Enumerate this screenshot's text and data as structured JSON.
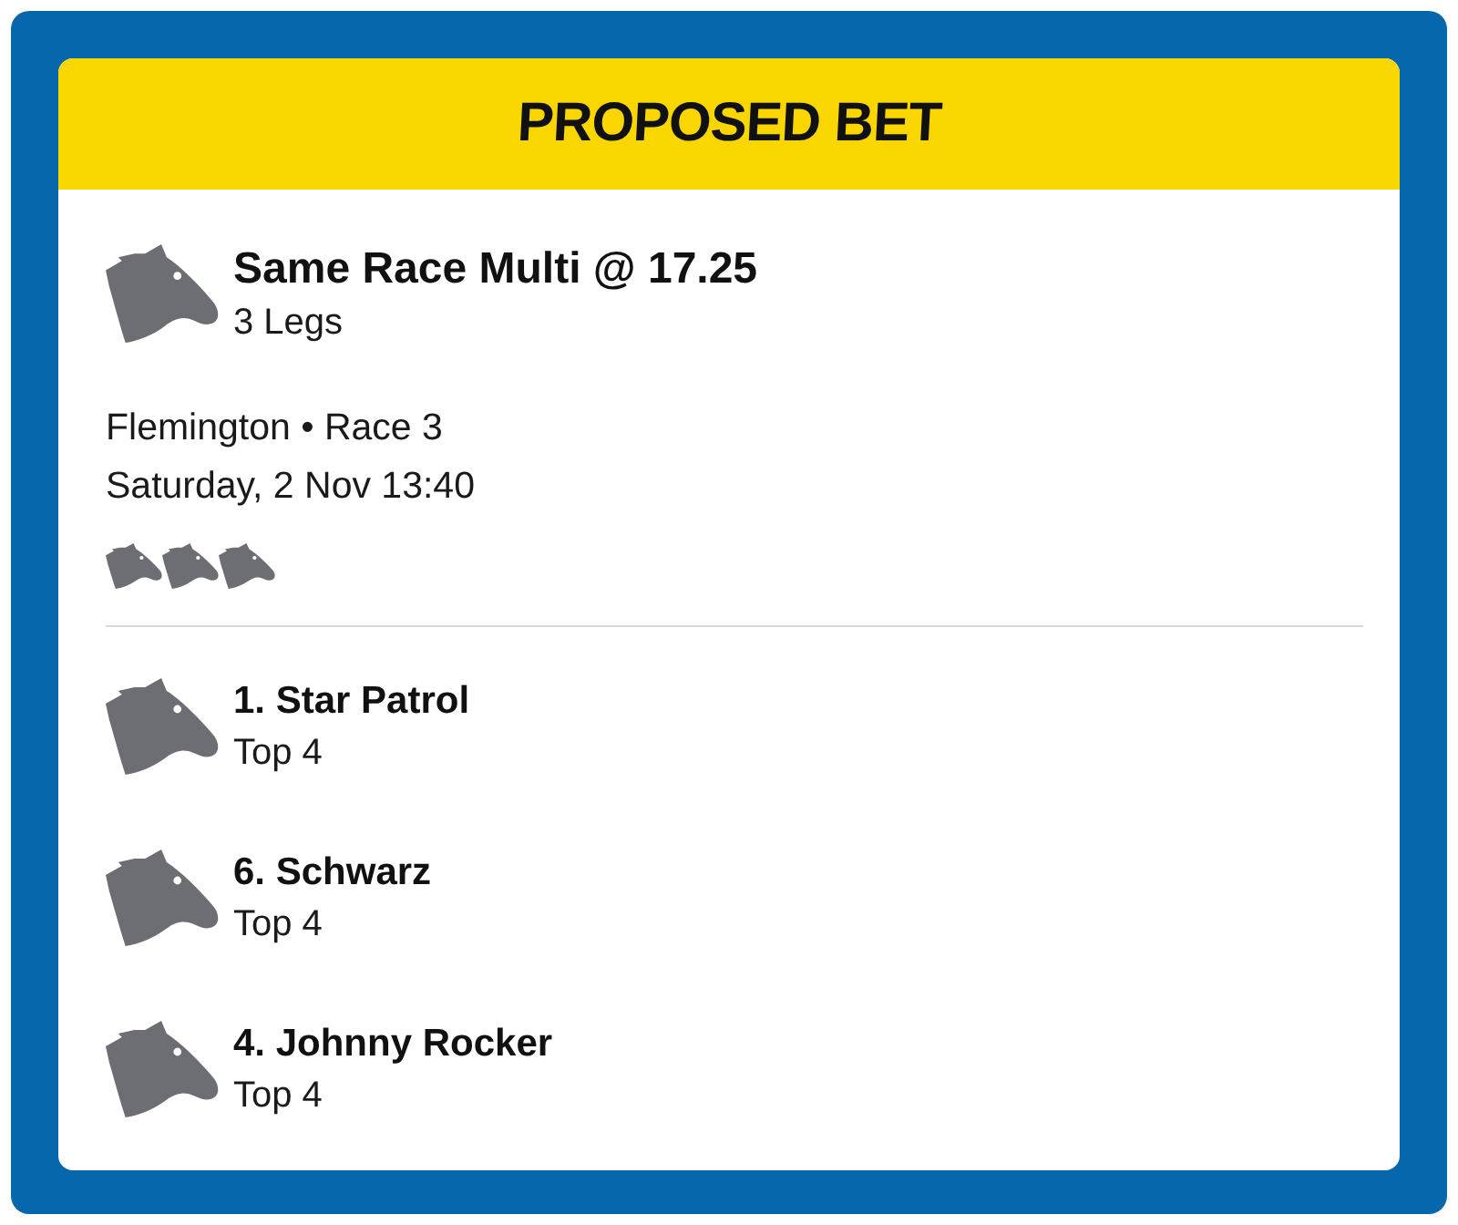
{
  "header": {
    "title": "PROPOSED BET"
  },
  "bet": {
    "title": "Same Race Multi @ 17.25",
    "subtitle": "3 Legs",
    "venue": "Flemington • Race 3",
    "date": "Saturday, 2 Nov 13:40"
  },
  "legs": [
    {
      "runner": "1. Star Patrol",
      "market": "Top 4"
    },
    {
      "runner": "6. Schwarz",
      "market": "Top 4"
    },
    {
      "runner": "4. Johnny Rocker",
      "market": "Top 4"
    }
  ]
}
